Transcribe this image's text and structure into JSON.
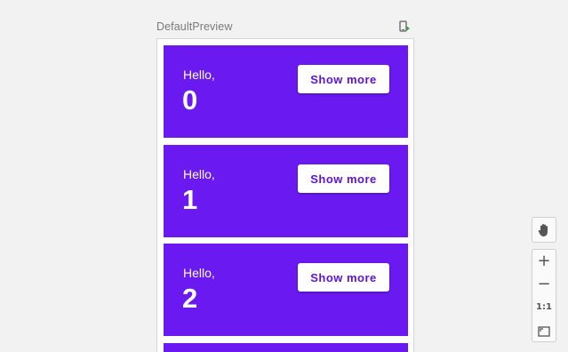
{
  "preview": {
    "title": "DefaultPreview",
    "deploy_icon": "deploy-to-device-icon"
  },
  "cards": [
    {
      "greeting": "Hello,",
      "number": "0",
      "button_label": "Show more"
    },
    {
      "greeting": "Hello,",
      "number": "1",
      "button_label": "Show more"
    },
    {
      "greeting": "Hello,",
      "number": "2",
      "button_label": "Show more"
    },
    {
      "greeting": "",
      "number": "",
      "button_label": ""
    }
  ],
  "toolbar": {
    "pan_icon": "hand-pan-icon",
    "zoom_in_label": "+",
    "zoom_out_label": "−",
    "zoom_actual_label": "1:1",
    "zoom_fit_icon": "zoom-to-fit-icon"
  },
  "colors": {
    "card_background": "#6a1af0",
    "button_text": "#5b12d6",
    "canvas_background": "#f2f2f2"
  }
}
